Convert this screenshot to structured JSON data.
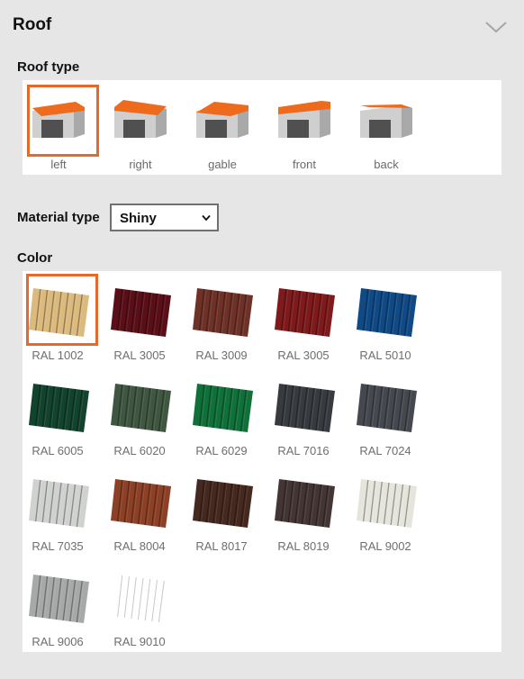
{
  "section": {
    "title": "Roof",
    "collapse_icon": "chevron-down-icon"
  },
  "roof_type": {
    "label": "Roof type",
    "selected": "left",
    "options": [
      {
        "id": "left",
        "label": "left"
      },
      {
        "id": "right",
        "label": "right"
      },
      {
        "id": "gable",
        "label": "gable"
      },
      {
        "id": "front",
        "label": "front"
      },
      {
        "id": "back",
        "label": "back"
      }
    ]
  },
  "material": {
    "label": "Material type",
    "value": "Shiny"
  },
  "color": {
    "label": "Color",
    "selected": "RAL 1002",
    "swatches": [
      {
        "label": "RAL 1002",
        "hex": "#dcba7e"
      },
      {
        "label": "RAL 3005",
        "hex": "#5a0f18"
      },
      {
        "label": "RAL 3009",
        "hex": "#6e3128"
      },
      {
        "label": "RAL 3005",
        "hex": "#7e1a1c"
      },
      {
        "label": "RAL 5010",
        "hex": "#104a86"
      },
      {
        "label": "RAL 6005",
        "hex": "#12432e"
      },
      {
        "label": "RAL 6020",
        "hex": "#3f5640"
      },
      {
        "label": "RAL 6029",
        "hex": "#10703a"
      },
      {
        "label": "RAL 7016",
        "hex": "#373b40"
      },
      {
        "label": "RAL 7024",
        "hex": "#45484e"
      },
      {
        "label": "RAL 7035",
        "hex": "#d0d2d0"
      },
      {
        "label": "RAL 8004",
        "hex": "#8c4025"
      },
      {
        "label": "RAL 8017",
        "hex": "#45281f"
      },
      {
        "label": "RAL 8019",
        "hex": "#433534"
      },
      {
        "label": "RAL 9002",
        "hex": "#e5e5dc"
      },
      {
        "label": "RAL 9006",
        "hex": "#a7a8a8"
      },
      {
        "label": "RAL 9010",
        "hex": "#ffffff"
      }
    ]
  },
  "colors": {
    "accent": "#e8682a",
    "roof_orange": "#ee6a1c",
    "panel_bg": "#ffffff",
    "page_bg": "#e6e6e6"
  }
}
